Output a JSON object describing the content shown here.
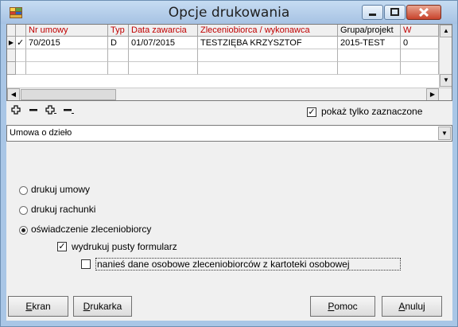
{
  "window": {
    "title": "Opcje drukowania"
  },
  "grid": {
    "columns": [
      "Nr umowy",
      "Typ",
      "Data zawarcia",
      "Zleceniobiorca / wykonawca",
      "Grupa/projekt",
      "W"
    ],
    "rows": [
      {
        "checked": "✓",
        "cells": [
          "70/2015",
          "D",
          "01/07/2015",
          "TESTZIĘBA KRZYSZTOF",
          "2015-TEST",
          "0"
        ]
      }
    ]
  },
  "toolbar": {
    "show_checked_label": "pokaż tylko zaznaczone",
    "show_checked": true
  },
  "combo": {
    "value": "Umowa o dzieło"
  },
  "options": {
    "radio1": "drukuj umowy",
    "radio2": "drukuj rachunki",
    "radio3": "oświadczenie zleceniobiorcy",
    "check1": "wydrukuj pusty formularz",
    "check2": "nanieś dane osobowe zleceniobiorców z kartoteki osobowej",
    "check1_checked": true,
    "check2_checked": false,
    "selected_radio": 3
  },
  "buttons": {
    "ekran_first": "E",
    "ekran_rest": "kran",
    "drukarka_first": "D",
    "drukarka_rest": "rukarka",
    "pomoc_first": "P",
    "pomoc_rest": "omoc",
    "anuluj_first": "A",
    "anuluj_rest": "nuluj"
  },
  "icons": [
    "app-table-icon",
    "minimize-icon",
    "maximize-icon",
    "close-icon",
    "add-record-icon",
    "delete-record-icon",
    "insert-record-icon",
    "post-record-icon"
  ],
  "colors": {
    "header_text": "#c00000",
    "titlebar": "#b4cfea",
    "close_button": "#c8432c"
  }
}
